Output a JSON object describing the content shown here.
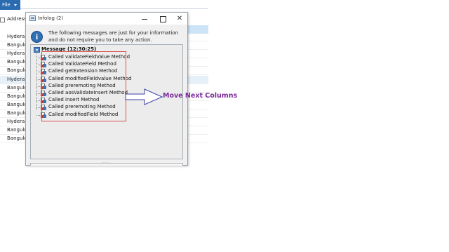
{
  "app": {
    "file_menu_label": "File",
    "grid_header_label": "Address",
    "rows": [
      "Hyderab",
      "Bangulo",
      "Hyderab",
      "Bangulo",
      "Bangulo",
      "Hyderab",
      "Bangulo",
      "Bangulo",
      "Bangulo",
      "Bangulo",
      "Hyderab",
      "Bangulo",
      "Bangulo"
    ]
  },
  "dialog": {
    "title": "Infolog (2)",
    "info_text": "The following messages are just for your information and do not require you to take any action.",
    "tree": {
      "root_label": "Message (12:30:25)",
      "items": [
        "Called validateFieldValue Method",
        "Called ValidateField Method",
        "Called getExtension Method",
        "Called modifiedFieldvalue Method",
        "Called preremoting Method",
        "Called aosValidateInsert Method",
        "Called insert Method",
        "Called preremoting Method",
        "Called modifiedField Method"
      ]
    },
    "splitter_glyph": "....",
    "close_glyph": "✕"
  },
  "annotation": {
    "text": "Move Next Columns",
    "color": "#7b2a9a",
    "box_color": "#d9534f"
  }
}
